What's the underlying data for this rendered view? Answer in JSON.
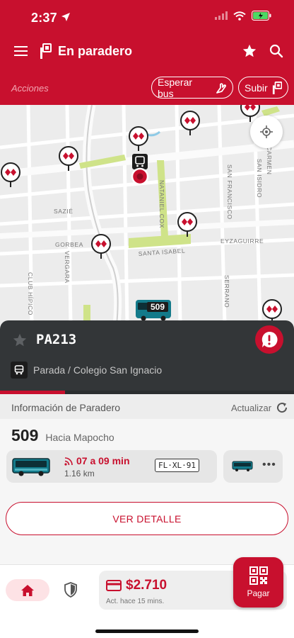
{
  "status_bar": {
    "time": "2:37"
  },
  "header": {
    "title": "En paradero",
    "actions_label": "Acciones",
    "wait_button": "Esperar bus",
    "board_button": "Subir"
  },
  "map": {
    "streets": {
      "sazie": "SAZIÉ",
      "gorbea": "GORBEA",
      "vergara": "VERGARA",
      "club_hipico": "CLUB HÍPICO",
      "nataniel_cox": "NATANIEL COX",
      "santa_isabel": "SANTA ISABEL",
      "san_francisco": "SAN FRANCISCO",
      "san_isidro": "SAN ISIDRO",
      "carmen": "CARMEN",
      "eyzaguirre": "EYZAGUIRRE",
      "serrano": "SERRANO"
    },
    "bus_marker_route": "509"
  },
  "stop": {
    "code": "PA213",
    "name": "Parada / Colegio San Ignacio",
    "progress_fraction": 0.22
  },
  "info": {
    "title": "Información de Paradero",
    "refresh_label": "Actualizar",
    "route_number": "509",
    "direction": "Hacia Mapocho",
    "arrival": {
      "eta": "07 a 09 min",
      "distance": "1.16 km",
      "plate": "FL·XL·91"
    },
    "more": "•••",
    "detail_button": "VER DETALLE"
  },
  "bottom_bar": {
    "balance": "$2.710",
    "updated": "Act. hace 15 mins.",
    "pay_label": "Pagar"
  },
  "colors": {
    "brand_red": "#c8102e",
    "panel_dark": "#333638",
    "park_green": "#cfe389",
    "bus_teal": "#137a8a"
  }
}
